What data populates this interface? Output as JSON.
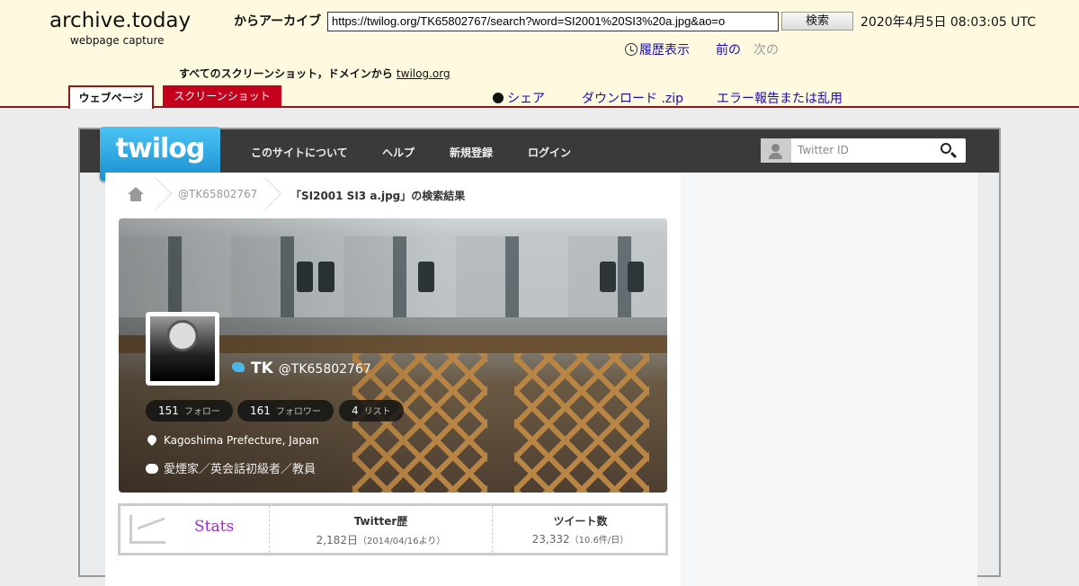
{
  "archive": {
    "logo": "archive.today",
    "logo_sub": "webpage capture",
    "from_label": "からアーカイブ",
    "url": "https://twilog.org/TK65802767/search?word=SI2001%20SI3%20a.jpg&ao=o",
    "search_button": "検索",
    "timestamp": "2020年4月5日 08:03:05 UTC",
    "history_label": "履歴表示",
    "prev_label": "前の",
    "next_label": "次の",
    "all_screenshots_label": "すべてのスクリーンショット，ドメインから",
    "domain_link": "twilog.org",
    "tab_webpage": "ウェブページ",
    "tab_screenshot": "スクリーンショット",
    "share_label": "シェア",
    "download_label": "ダウンロード .zip",
    "report_label": "エラー報告または乱用"
  },
  "twilog": {
    "logo": "twilog",
    "nav": [
      "このサイトについて",
      "ヘルプ",
      "新規登録",
      "ログイン"
    ],
    "search_placeholder": "Twitter ID",
    "breadcrumb": [
      "@TK65802767",
      "「SI2001 SI3 a.jpg」の検索結果"
    ],
    "profile": {
      "name": "TK",
      "handle": "@TK65802767",
      "follow_count": "151",
      "follow_label": "フォロー",
      "follower_count": "161",
      "follower_label": "フォロワー",
      "list_count": "4",
      "list_label": "リスト",
      "location": "Kagoshima Prefecture, Japan",
      "bio": "愛煙家／英会話初級者／教員"
    },
    "stats": {
      "label": "Stats",
      "history_title": "Twitter歴",
      "history_value": "2,182日",
      "history_note": "（2014/04/16より）",
      "tweets_title": "ツイート数",
      "tweets_value": "23,332",
      "tweets_note": "（10.6件/日）"
    }
  },
  "colors": {
    "archive_bg": "#fff9e0",
    "archive_red": "#c4001c",
    "link_blue": "#1a0dab",
    "twilog_blue": "#1a8fd0",
    "stats_purple": "#9b2fc9"
  }
}
